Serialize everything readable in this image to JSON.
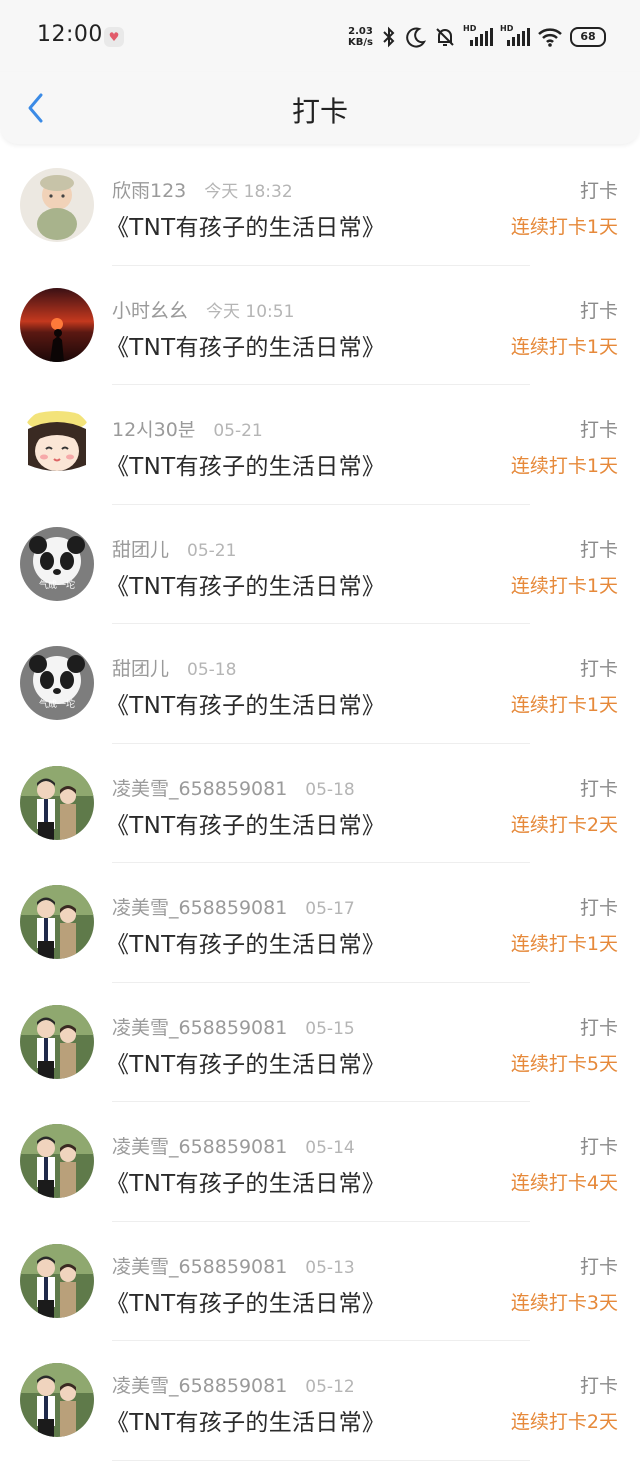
{
  "status_bar": {
    "time": "12:00",
    "speed_value": "2.03",
    "speed_unit": "KB/s",
    "signal_label": "HD",
    "battery": "68",
    "icons": [
      "notification-heart-icon",
      "bluetooth-icon",
      "moon-icon",
      "bell-off-icon",
      "signal-icon",
      "signal-icon",
      "wifi-icon",
      "battery-icon"
    ]
  },
  "header": {
    "title": "打卡",
    "back_icon": "chevron-left-icon"
  },
  "colors": {
    "accent": "#e6893a",
    "back": "#3b8be6",
    "muted": "#9a9a9a"
  },
  "records": [
    {
      "user": "欣雨123",
      "time": "今天 18:32",
      "book": "《TNT有孩子的生活日常》",
      "tag": "打卡",
      "streak": "连续打卡1天",
      "avatar": "baby"
    },
    {
      "user": "小时幺幺",
      "time": "今天 10:51",
      "book": "《TNT有孩子的生活日常》",
      "tag": "打卡",
      "streak": "连续打卡1天",
      "avatar": "sunset"
    },
    {
      "user": "12시30분",
      "time": "05-21",
      "book": "《TNT有孩子的生活日常》",
      "tag": "打卡",
      "streak": "连续打卡1天",
      "avatar": "cartoon-girl"
    },
    {
      "user": "甜团儿",
      "time": "05-21",
      "book": "《TNT有孩子的生活日常》",
      "tag": "打卡",
      "streak": "连续打卡1天",
      "avatar": "panda",
      "avatar_text": "气成一坨"
    },
    {
      "user": "甜团儿",
      "time": "05-18",
      "book": "《TNT有孩子的生活日常》",
      "tag": "打卡",
      "streak": "连续打卡1天",
      "avatar": "panda",
      "avatar_text": "气成一坨"
    },
    {
      "user": "凌美雪_658859081",
      "time": "05-18",
      "book": "《TNT有孩子的生活日常》",
      "tag": "打卡",
      "streak": "连续打卡2天",
      "avatar": "couple"
    },
    {
      "user": "凌美雪_658859081",
      "time": "05-17",
      "book": "《TNT有孩子的生活日常》",
      "tag": "打卡",
      "streak": "连续打卡1天",
      "avatar": "couple"
    },
    {
      "user": "凌美雪_658859081",
      "time": "05-15",
      "book": "《TNT有孩子的生活日常》",
      "tag": "打卡",
      "streak": "连续打卡5天",
      "avatar": "couple"
    },
    {
      "user": "凌美雪_658859081",
      "time": "05-14",
      "book": "《TNT有孩子的生活日常》",
      "tag": "打卡",
      "streak": "连续打卡4天",
      "avatar": "couple"
    },
    {
      "user": "凌美雪_658859081",
      "time": "05-13",
      "book": "《TNT有孩子的生活日常》",
      "tag": "打卡",
      "streak": "连续打卡3天",
      "avatar": "couple"
    },
    {
      "user": "凌美雪_658859081",
      "time": "05-12",
      "book": "《TNT有孩子的生活日常》",
      "tag": "打卡",
      "streak": "连续打卡2天",
      "avatar": "couple"
    }
  ]
}
